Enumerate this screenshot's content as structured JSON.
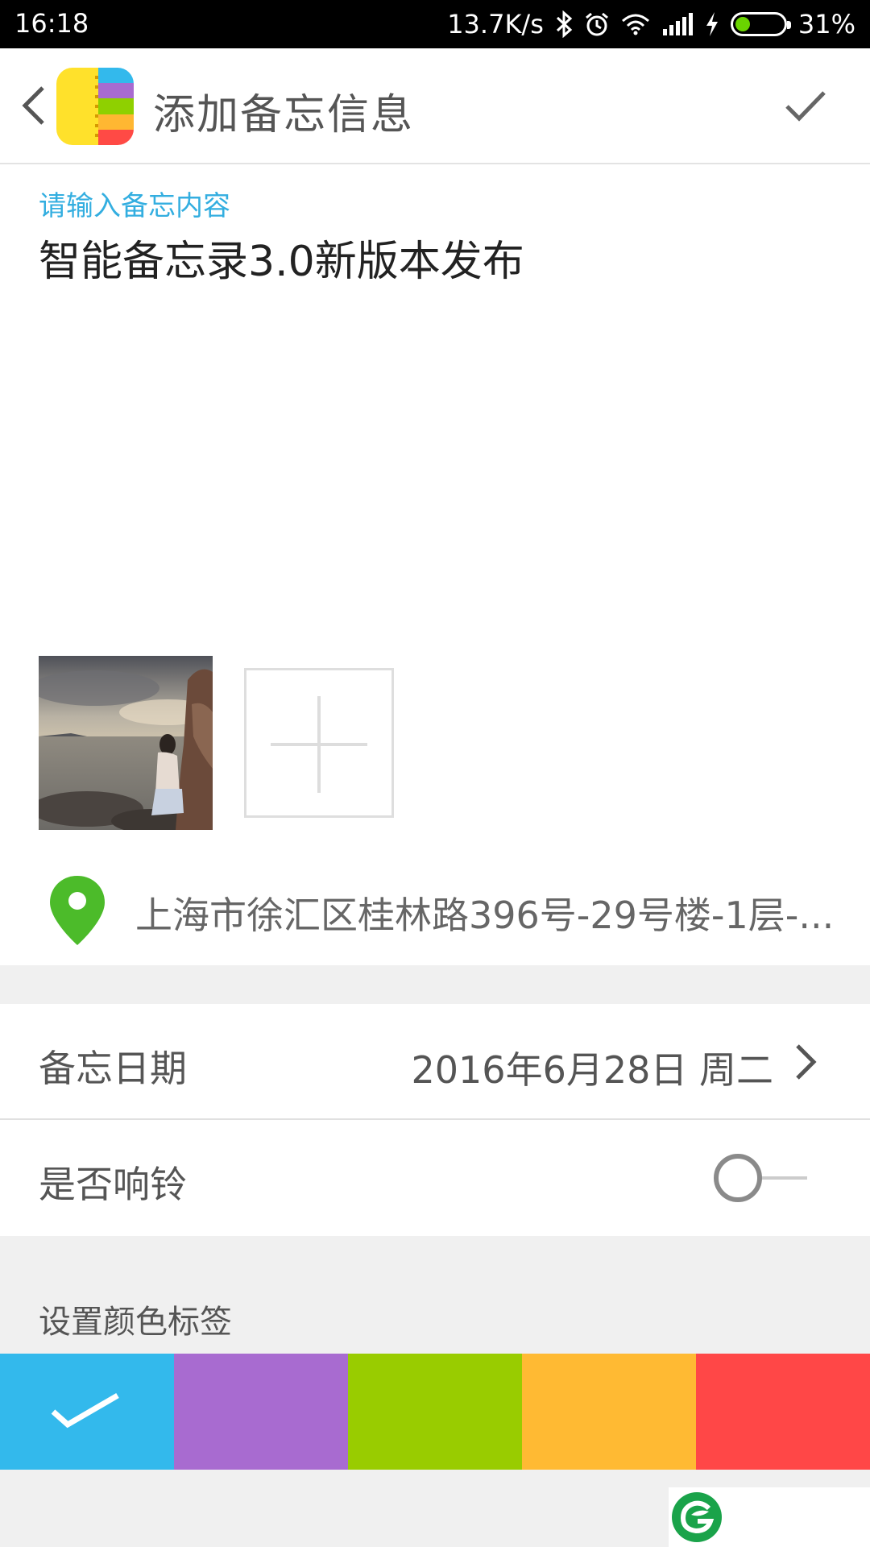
{
  "status_bar": {
    "time": "16:18",
    "network_speed": "13.7K/s",
    "battery_percent": "31%",
    "battery_level": 0.31,
    "icons": [
      "bluetooth-icon",
      "alarm-icon",
      "wifi-icon",
      "signal-icon",
      "charging-icon",
      "battery-icon"
    ]
  },
  "app_bar": {
    "title": "添加备忘信息",
    "logo_colors": [
      "#ffe12b",
      "#33b9ec",
      "#a86bd0",
      "#8fd000",
      "#ffb732",
      "#ff4a45"
    ]
  },
  "memo": {
    "hint": "请输入备忘内容",
    "content": "智能备忘录3.0新版本发布"
  },
  "location": {
    "address": "上海市徐汇区桂林路396号-29号楼-1层-...",
    "pin_color": "#4cbb2a"
  },
  "settings": {
    "date_label": "备忘日期",
    "date_value": "2016年6月28日 周二",
    "ring_label": "是否响铃",
    "ring_enabled": false
  },
  "color_tags": {
    "title": "设置颜色标签",
    "swatches": [
      {
        "name": "blue",
        "color": "#33b9ec",
        "selected": true
      },
      {
        "name": "purple",
        "color": "#a86bd0",
        "selected": false
      },
      {
        "name": "green",
        "color": "#99cc00",
        "selected": false
      },
      {
        "name": "orange",
        "color": "#ffba33",
        "selected": false
      },
      {
        "name": "red",
        "color": "#ff4747",
        "selected": false
      }
    ]
  },
  "colors": {
    "accent": "#33aee0",
    "background_gray": "#f0f0f0"
  }
}
